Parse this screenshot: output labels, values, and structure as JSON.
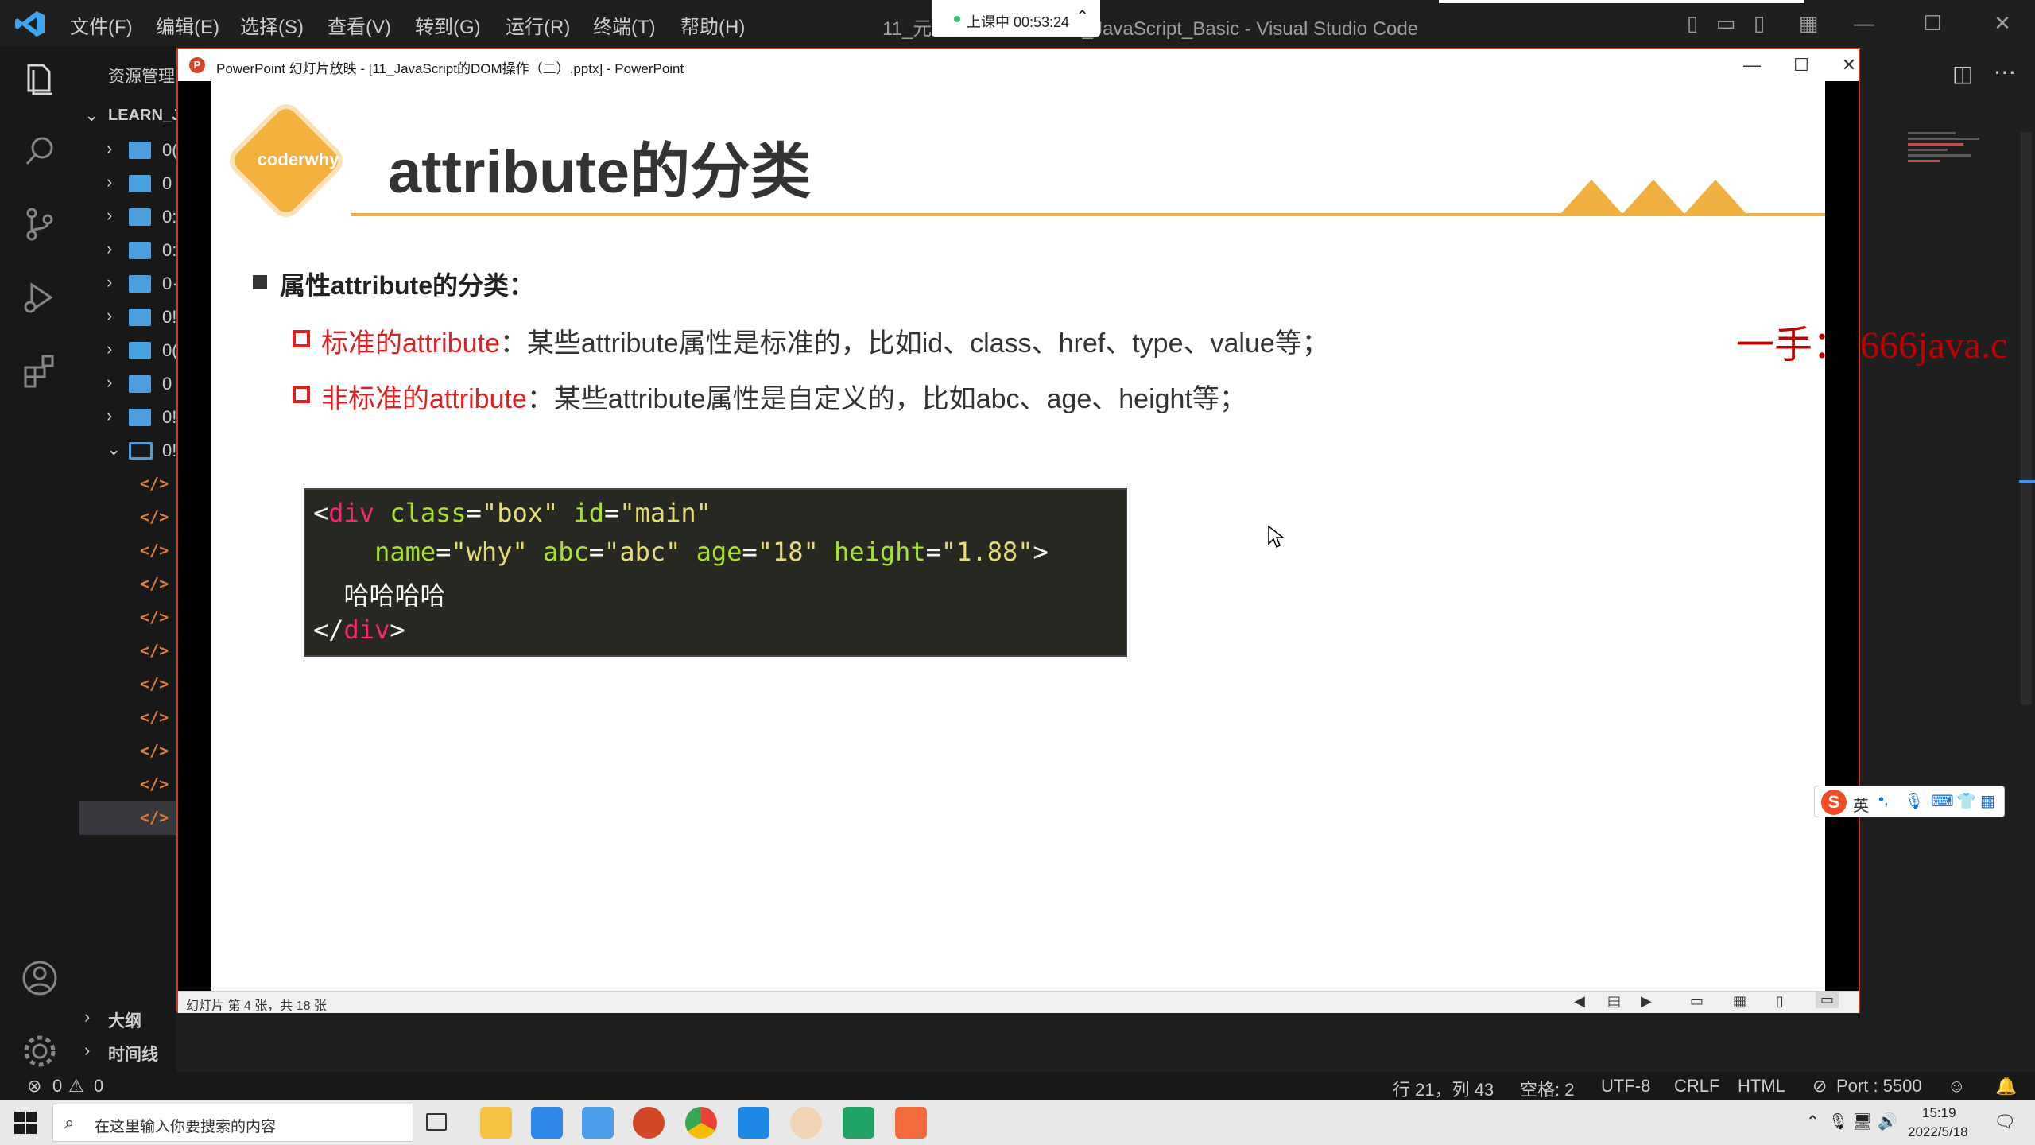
{
  "titlebar": {
    "menu": [
      "文件(F)",
      "编辑(E)",
      "选择(S)",
      "查看(V)",
      "转到(G)",
      "运行(R)",
      "终端(T)",
      "帮助(H)"
    ],
    "window_title": "11_元      分类.html - Learn_JavaScript_Basic - Visual Studio Code"
  },
  "recording": {
    "label": "上课中 00:53:24"
  },
  "sidebar": {
    "header": "资源管理",
    "root": "LEARN_J",
    "folders": [
      "0(",
      "0",
      "0:",
      "0:",
      "0·",
      "0!",
      "0(",
      "0",
      "0!",
      "0!"
    ],
    "outline": "大纲",
    "timeline": "时间线"
  },
  "ppt": {
    "title": "PowerPoint 幻灯片放映 - [11_JavaScript的DOM操作（二）.pptx] - PowerPoint",
    "status": "幻灯片 第 4 张，共 18 张",
    "slide": {
      "logo": "coderwhy",
      "title": "attribute的分类",
      "bullet": "属性attribute的分类：",
      "sub1_red": "标准的attribute",
      "sub1_text": "：某些attribute属性是标准的，比如id、class、href、type、value等；",
      "sub2_red": "非标准的attribute",
      "sub2_text": "：某些attribute属性是自定义的，比如abc、age、height等；",
      "code": {
        "l1": [
          "<",
          "div",
          " class",
          "=",
          "\"box\"",
          " id",
          "=",
          "\"main\""
        ],
        "l2": [
          "name",
          "=",
          "\"why\"",
          " abc",
          "=",
          "\"abc\"",
          " age",
          "=",
          "\"18\"",
          " height",
          "=",
          "\"1.88\"",
          ">"
        ],
        "l3": "哈哈哈哈",
        "l4": [
          "</",
          "div",
          ">"
        ]
      }
    }
  },
  "watermark": "一手： 666java.c",
  "ime": {
    "lang": "英"
  },
  "statusbar": {
    "errors": "0",
    "warnings": "0",
    "position": "行 21，列 43",
    "spaces": "空格: 2",
    "encoding": "UTF-8",
    "eol": "CRLF",
    "language": "HTML",
    "port": "Port : 5500"
  },
  "taskbar": {
    "search_placeholder": "在这里输入你要搜索的内容",
    "time": "15:19",
    "date": "2022/5/18"
  }
}
